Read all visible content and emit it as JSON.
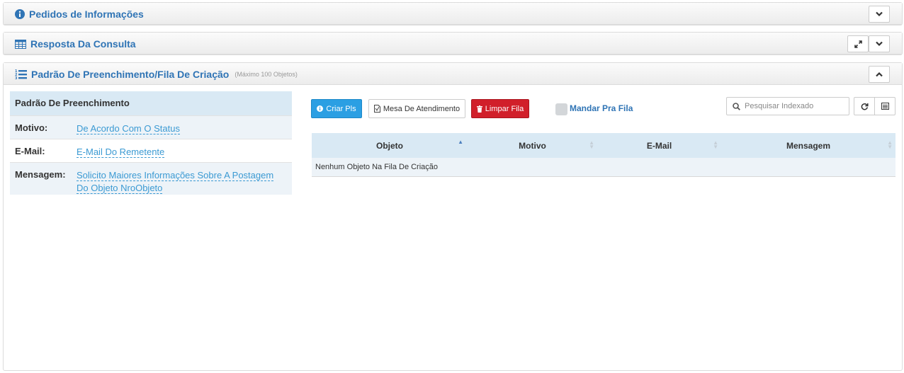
{
  "panels": {
    "pedidos": {
      "title": "Pedidos de Informações"
    },
    "resposta": {
      "title": "Resposta Da Consulta"
    },
    "padrao": {
      "title": "Padrão De Preenchimento/Fila De Criação",
      "subtitle": "(Máximo 100 Objetos)"
    }
  },
  "fill_pattern": {
    "header": "Padrão De Preenchimento",
    "rows": [
      {
        "label": "Motivo:",
        "value": "De Acordo Com O Status"
      },
      {
        "label": "E-Mail:",
        "value": "E-Mail Do Remetente"
      },
      {
        "label": "Mensagem:",
        "value_line1": "Solicito Maiores Informações Sobre A Postagem",
        "value_line2": "Do Objeto NroObjeto"
      }
    ]
  },
  "toolbar": {
    "criar_label": "Criar Pls",
    "mesa_label": "Mesa De Atendimento",
    "limpar_label": "Limpar Fila",
    "mandar_label": "Mandar Pra Fila",
    "search_placeholder": "Pesquisar Indexado"
  },
  "queue_table": {
    "columns": [
      "Objeto",
      "Motivo",
      "E-Mail",
      "Mensagem"
    ],
    "empty_message": "Nenhum Objeto Na Fila De Criação"
  },
  "colors": {
    "accent_blue": "#2f74b5",
    "primary_button": "#2b9fe3",
    "danger_button": "#d11f2a",
    "link": "#3b9ad3",
    "header_bg": "#d9e9f4"
  }
}
